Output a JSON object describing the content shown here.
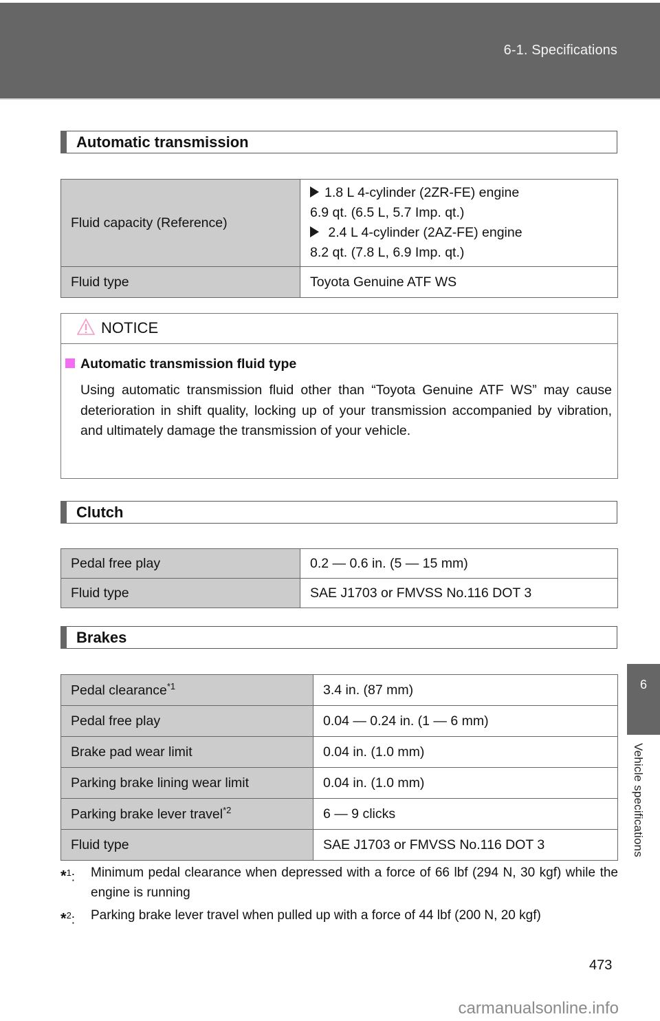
{
  "header": {
    "section_ref": "6-1. Specifications"
  },
  "side_tab": {
    "chapter_number": "6",
    "chapter_title": "Vehicle specifications"
  },
  "sections": {
    "automatic_transmission": {
      "title": "Automatic transmission",
      "rows": [
        {
          "label": "Fluid capacity (Reference)",
          "entries": [
            {
              "engine": "1.8 L 4-cylinder (2ZR-FE) engine",
              "capacity": "6.9 qt. (6.5 L, 5.7 Imp. qt.)"
            },
            {
              "engine": "2.4 L 4-cylinder (2AZ-FE) engine",
              "capacity": "8.2 qt. (7.8 L, 6.9 Imp. qt.)"
            }
          ]
        },
        {
          "label": "Fluid type",
          "value": "Toyota Genuine ATF WS"
        }
      ]
    },
    "notice": {
      "label": "NOTICE",
      "icon": "warning-triangle-icon",
      "accent_color": "#f46cf4",
      "subheading": "Automatic transmission fluid type",
      "body": "Using automatic transmission fluid other than “Toyota Genuine ATF WS” may cause deterioration in shift quality, locking up of your transmission accompanied by vibration, and ultimately damage the transmission of your vehicle."
    },
    "clutch": {
      "title": "Clutch",
      "rows": [
        {
          "label": "Pedal free play",
          "value": "0.2 — 0.6 in. (5 — 15 mm)"
        },
        {
          "label": "Fluid type",
          "value": "SAE J1703 or FMVSS No.116 DOT 3"
        }
      ]
    },
    "brakes": {
      "title": "Brakes",
      "rows": [
        {
          "label": "Pedal clearance",
          "note": "*1",
          "value": "3.4 in. (87 mm)"
        },
        {
          "label": "Pedal free play",
          "value": "0.04 — 0.24 in. (1 — 6 mm)"
        },
        {
          "label": "Brake pad wear limit",
          "value": "0.04 in. (1.0 mm)"
        },
        {
          "label": "Parking brake lining wear limit",
          "value": "0.04 in. (1.0 mm)"
        },
        {
          "label": "Parking brake lever travel",
          "note": "*2",
          "value": "6 — 9 clicks"
        },
        {
          "label": "Fluid type",
          "value": "SAE J1703 or FMVSS No.116 DOT 3"
        }
      ]
    }
  },
  "footnotes": [
    {
      "star": "*",
      "num": "1",
      "text": "Minimum pedal clearance when depressed with a force of 66 lbf (294 N, 30 kgf) while the engine is running"
    },
    {
      "star": "*",
      "num": "2",
      "text": "Parking brake lever travel when pulled up with a force of 44 lbf (200 N, 20 kgf)"
    }
  ],
  "page_number": "473",
  "watermark": "carmanualsonline.info"
}
